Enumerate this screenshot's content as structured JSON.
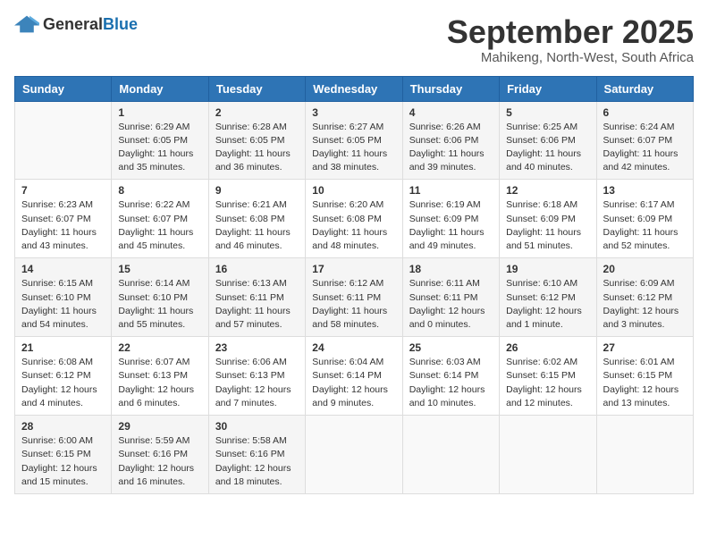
{
  "logo": {
    "general": "General",
    "blue": "Blue"
  },
  "title": "September 2025",
  "subtitle": "Mahikeng, North-West, South Africa",
  "days_header": [
    "Sunday",
    "Monday",
    "Tuesday",
    "Wednesday",
    "Thursday",
    "Friday",
    "Saturday"
  ],
  "weeks": [
    [
      {
        "num": "",
        "info": ""
      },
      {
        "num": "1",
        "info": "Sunrise: 6:29 AM\nSunset: 6:05 PM\nDaylight: 11 hours\nand 35 minutes."
      },
      {
        "num": "2",
        "info": "Sunrise: 6:28 AM\nSunset: 6:05 PM\nDaylight: 11 hours\nand 36 minutes."
      },
      {
        "num": "3",
        "info": "Sunrise: 6:27 AM\nSunset: 6:05 PM\nDaylight: 11 hours\nand 38 minutes."
      },
      {
        "num": "4",
        "info": "Sunrise: 6:26 AM\nSunset: 6:06 PM\nDaylight: 11 hours\nand 39 minutes."
      },
      {
        "num": "5",
        "info": "Sunrise: 6:25 AM\nSunset: 6:06 PM\nDaylight: 11 hours\nand 40 minutes."
      },
      {
        "num": "6",
        "info": "Sunrise: 6:24 AM\nSunset: 6:07 PM\nDaylight: 11 hours\nand 42 minutes."
      }
    ],
    [
      {
        "num": "7",
        "info": "Sunrise: 6:23 AM\nSunset: 6:07 PM\nDaylight: 11 hours\nand 43 minutes."
      },
      {
        "num": "8",
        "info": "Sunrise: 6:22 AM\nSunset: 6:07 PM\nDaylight: 11 hours\nand 45 minutes."
      },
      {
        "num": "9",
        "info": "Sunrise: 6:21 AM\nSunset: 6:08 PM\nDaylight: 11 hours\nand 46 minutes."
      },
      {
        "num": "10",
        "info": "Sunrise: 6:20 AM\nSunset: 6:08 PM\nDaylight: 11 hours\nand 48 minutes."
      },
      {
        "num": "11",
        "info": "Sunrise: 6:19 AM\nSunset: 6:09 PM\nDaylight: 11 hours\nand 49 minutes."
      },
      {
        "num": "12",
        "info": "Sunrise: 6:18 AM\nSunset: 6:09 PM\nDaylight: 11 hours\nand 51 minutes."
      },
      {
        "num": "13",
        "info": "Sunrise: 6:17 AM\nSunset: 6:09 PM\nDaylight: 11 hours\nand 52 minutes."
      }
    ],
    [
      {
        "num": "14",
        "info": "Sunrise: 6:15 AM\nSunset: 6:10 PM\nDaylight: 11 hours\nand 54 minutes."
      },
      {
        "num": "15",
        "info": "Sunrise: 6:14 AM\nSunset: 6:10 PM\nDaylight: 11 hours\nand 55 minutes."
      },
      {
        "num": "16",
        "info": "Sunrise: 6:13 AM\nSunset: 6:11 PM\nDaylight: 11 hours\nand 57 minutes."
      },
      {
        "num": "17",
        "info": "Sunrise: 6:12 AM\nSunset: 6:11 PM\nDaylight: 11 hours\nand 58 minutes."
      },
      {
        "num": "18",
        "info": "Sunrise: 6:11 AM\nSunset: 6:11 PM\nDaylight: 12 hours\nand 0 minutes."
      },
      {
        "num": "19",
        "info": "Sunrise: 6:10 AM\nSunset: 6:12 PM\nDaylight: 12 hours\nand 1 minute."
      },
      {
        "num": "20",
        "info": "Sunrise: 6:09 AM\nSunset: 6:12 PM\nDaylight: 12 hours\nand 3 minutes."
      }
    ],
    [
      {
        "num": "21",
        "info": "Sunrise: 6:08 AM\nSunset: 6:12 PM\nDaylight: 12 hours\nand 4 minutes."
      },
      {
        "num": "22",
        "info": "Sunrise: 6:07 AM\nSunset: 6:13 PM\nDaylight: 12 hours\nand 6 minutes."
      },
      {
        "num": "23",
        "info": "Sunrise: 6:06 AM\nSunset: 6:13 PM\nDaylight: 12 hours\nand 7 minutes."
      },
      {
        "num": "24",
        "info": "Sunrise: 6:04 AM\nSunset: 6:14 PM\nDaylight: 12 hours\nand 9 minutes."
      },
      {
        "num": "25",
        "info": "Sunrise: 6:03 AM\nSunset: 6:14 PM\nDaylight: 12 hours\nand 10 minutes."
      },
      {
        "num": "26",
        "info": "Sunrise: 6:02 AM\nSunset: 6:15 PM\nDaylight: 12 hours\nand 12 minutes."
      },
      {
        "num": "27",
        "info": "Sunrise: 6:01 AM\nSunset: 6:15 PM\nDaylight: 12 hours\nand 13 minutes."
      }
    ],
    [
      {
        "num": "28",
        "info": "Sunrise: 6:00 AM\nSunset: 6:15 PM\nDaylight: 12 hours\nand 15 minutes."
      },
      {
        "num": "29",
        "info": "Sunrise: 5:59 AM\nSunset: 6:16 PM\nDaylight: 12 hours\nand 16 minutes."
      },
      {
        "num": "30",
        "info": "Sunrise: 5:58 AM\nSunset: 6:16 PM\nDaylight: 12 hours\nand 18 minutes."
      },
      {
        "num": "",
        "info": ""
      },
      {
        "num": "",
        "info": ""
      },
      {
        "num": "",
        "info": ""
      },
      {
        "num": "",
        "info": ""
      }
    ]
  ]
}
